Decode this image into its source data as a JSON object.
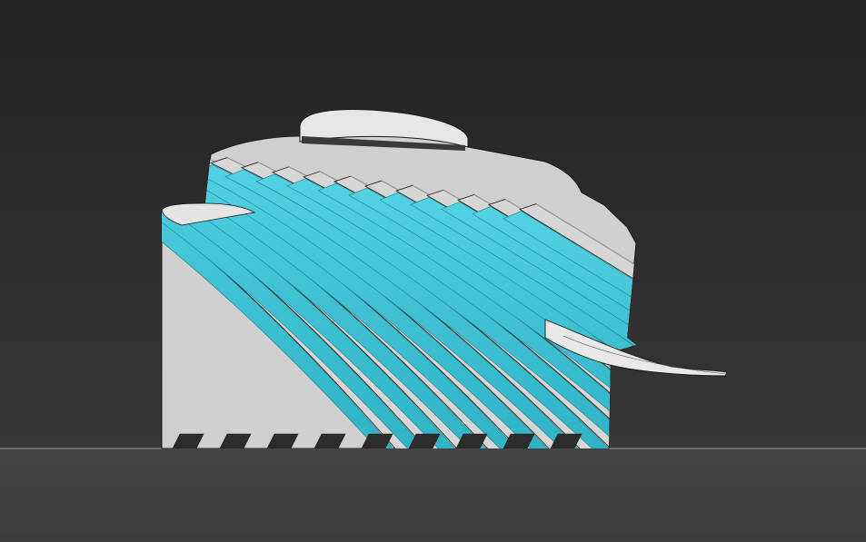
{
  "viewport": {
    "background_top": "#232323",
    "background_bottom": "#3d3d3d",
    "ground_color": "#404040",
    "horizon_line_color": "#6f6f6f"
  },
  "model": {
    "description_icon": "twisted-fin-tower-model",
    "fin_color": "#d6d6d6",
    "fin_shadow_color": "#9a9a9a",
    "glass_color": "#3ec4d6",
    "glass_dark_color": "#1e7f8c",
    "outline_color": "#1a1a1a"
  }
}
